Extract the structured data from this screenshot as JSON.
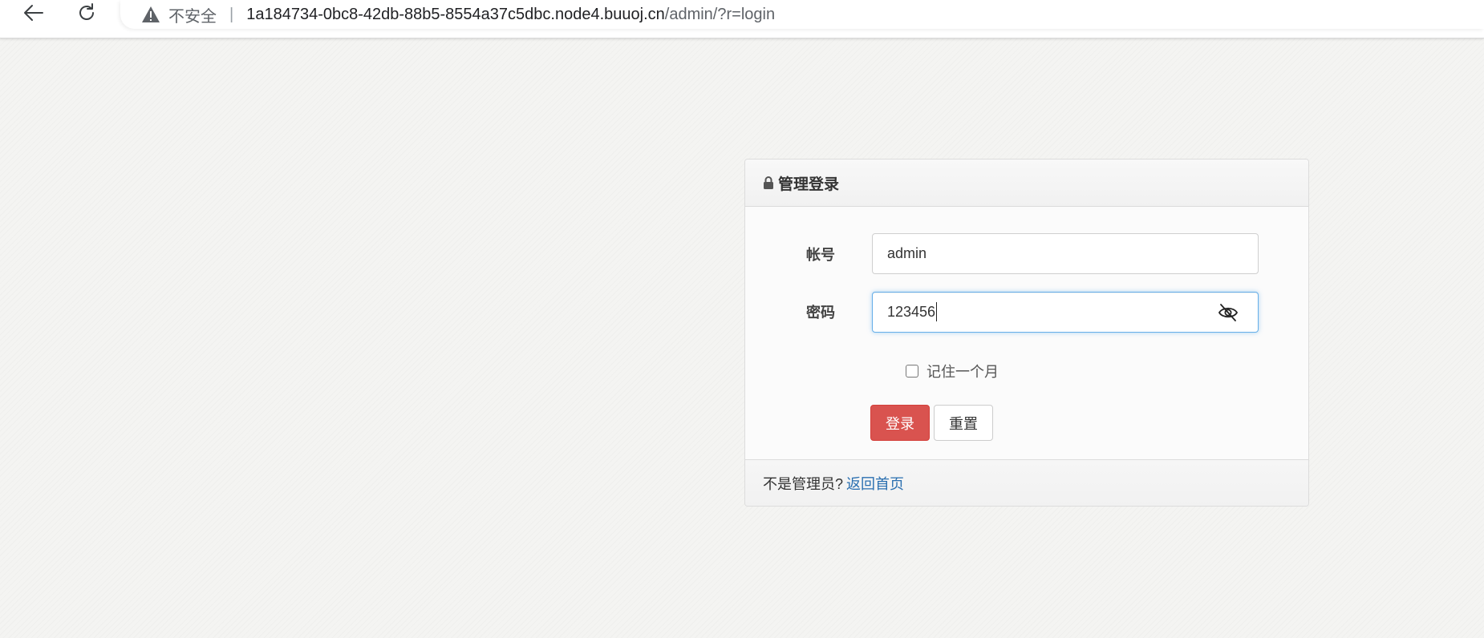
{
  "browser": {
    "security_label": "不安全",
    "separator": "|",
    "url_host": "1a184734-0bc8-42db-88b5-8554a37c5dbc.node4.buuoj.cn",
    "url_path": "/admin/?r=login"
  },
  "login_panel": {
    "title": "管理登录",
    "account_label": "帐号",
    "account_value": "admin",
    "password_label": "密码",
    "password_value": "123456",
    "remember_label": "记住一个月",
    "remember_checked": false,
    "login_button": "登录",
    "reset_button": "重置",
    "footer_text": "不是管理员?",
    "footer_link": "返回首页"
  },
  "colors": {
    "login_button": "#d9534f",
    "link": "#2a6fb0",
    "focus_border": "#66afe9"
  },
  "icons": {
    "back": "back-arrow-icon",
    "reload": "reload-icon",
    "warning": "warning-icon",
    "lock": "lock-icon",
    "password_visibility": "eye-off-icon"
  }
}
